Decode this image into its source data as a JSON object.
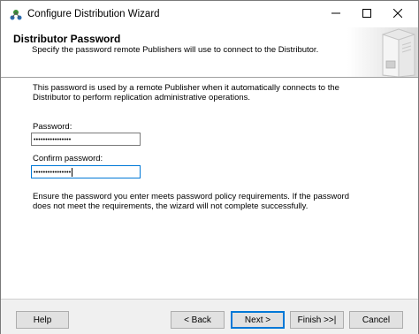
{
  "window": {
    "title": "Configure Distribution Wizard",
    "controls": {
      "minimize_icon": "minimize-icon",
      "maximize_icon": "maximize-icon",
      "close_icon": "close-icon"
    }
  },
  "header": {
    "title": "Distributor Password",
    "subtitle": "Specify the password remote Publishers will use to connect to the Distributor."
  },
  "content": {
    "intro_line1": "This password is used by a remote Publisher when it automatically connects to the",
    "intro_line2": "Distributor to perform replication administrative operations.",
    "password_label": "Password:",
    "password_value": "••••••••••••••••",
    "confirm_label": "Confirm password:",
    "confirm_value": "••••••••••••••••",
    "note_line1": "Ensure the password you enter meets password policy requirements. If the password",
    "note_line2": "does not meet the requirements, the wizard will not complete successfully."
  },
  "footer": {
    "help": "Help",
    "back": "< Back",
    "next": "Next >",
    "finish": "Finish >>|",
    "cancel": "Cancel"
  },
  "colors": {
    "focus_accent": "#0078d7",
    "footer_bg": "#f0f0f0",
    "button_bg": "#e1e1e1"
  }
}
